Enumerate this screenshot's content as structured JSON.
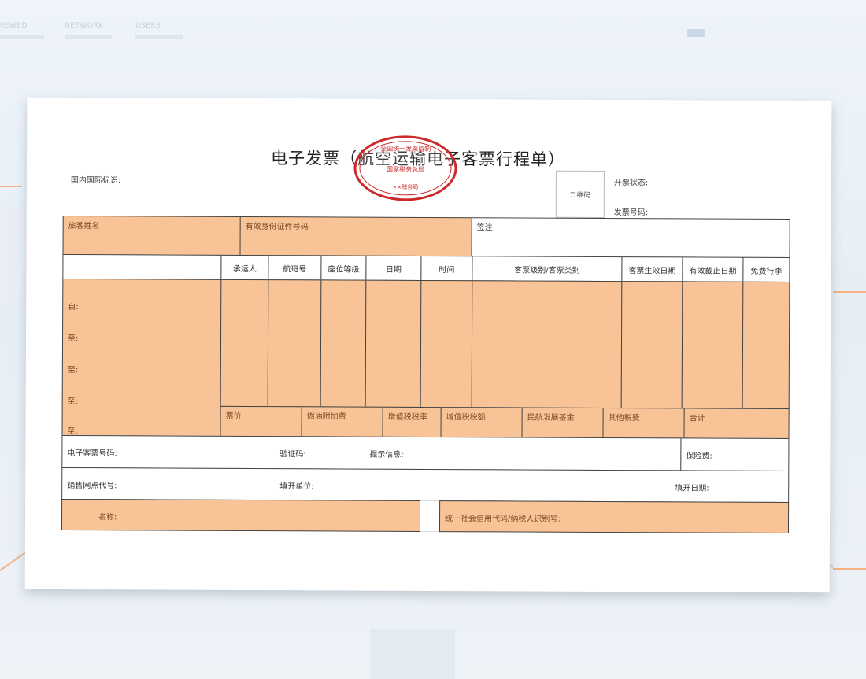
{
  "background_tabs": [
    "VIEWED",
    "NETWORK",
    "USERS"
  ],
  "colors": {
    "orange_fill": "#f8c397",
    "seal_red": "#cc2a2a",
    "border": "#444444",
    "accent_line": "#f6b184"
  },
  "invoice": {
    "title": "电子发票（航空运输电子客票行程单）",
    "domestic_intl_flag": "国内国际标识:",
    "issue_status": "开票状态:",
    "invoice_number": "发票号码:",
    "qr_code": "二维码",
    "seal": {
      "line1": "全国统一发票监制",
      "line2": "国家税务总局",
      "line3": "××税务局"
    },
    "passenger_name": "旅客姓名",
    "id_number": "有效身份证件号码",
    "remarks": "签注",
    "columns": [
      "承运人",
      "航班号",
      "座位等级",
      "日期",
      "时间",
      "客票级别/客票类别",
      "客票生效日期",
      "有效截止日期",
      "免费行李"
    ],
    "route_rows": [
      "自:",
      "至:",
      "至:",
      "至:",
      "至:"
    ],
    "fees": [
      "票价",
      "燃油附加费",
      "增值税税率",
      "增值税税额",
      "民航发展基金",
      "其他税费",
      "合计"
    ],
    "e_ticket_number": "电子客票号码:",
    "verification_code": "验证码:",
    "notice": "提示信息:",
    "insurance": "保险费:",
    "agent_code": "销售网点代号:",
    "issuer": "填开单位:",
    "issue_date": "填开日期:",
    "buyer_name": "名称:",
    "buyer_tax_id": "统一社会信用代码/纳税人识别号:"
  }
}
